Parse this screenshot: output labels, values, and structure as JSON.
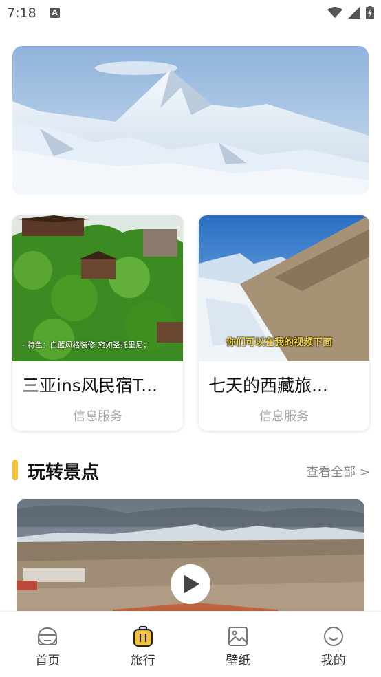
{
  "status_bar": {
    "time": "7:18",
    "notification_badge": "A"
  },
  "hero": {
    "image": "snow-mountain-landscape"
  },
  "cards": [
    {
      "title": "三亚ins风民宿T...",
      "subtitle": "信息服务",
      "image": "jungle-villas",
      "caption": "- 特色：白蓝风格装修 宛如圣托里尼；"
    },
    {
      "title": "七天的西藏旅...",
      "subtitle": "信息服务",
      "image": "tibet-glacier-valley",
      "caption": "你们可以在我的视频下面"
    }
  ],
  "section": {
    "title": "玩转景点",
    "link": "查看全部 >"
  },
  "video": {
    "image": "tibet-plateau-town"
  },
  "bottom_nav": {
    "items": [
      {
        "label": "首页",
        "icon": "home-icon"
      },
      {
        "label": "旅行",
        "icon": "luggage-icon",
        "active": true
      },
      {
        "label": "壁纸",
        "icon": "image-icon"
      },
      {
        "label": "我的",
        "icon": "smile-icon"
      }
    ]
  },
  "colors": {
    "accent": "#f6c43a",
    "active_icon": "#f6c43a",
    "text_muted": "#aaaaaa"
  }
}
